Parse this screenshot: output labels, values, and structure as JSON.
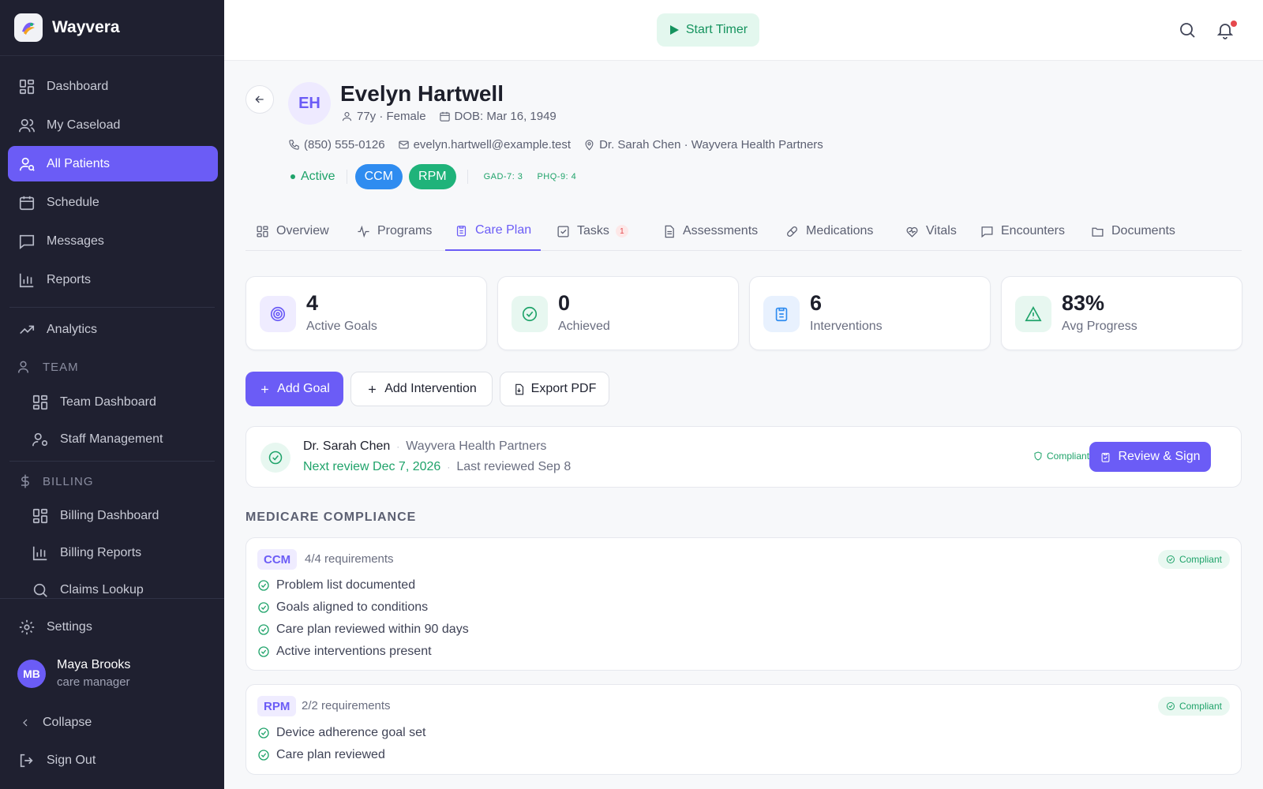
{
  "app": {
    "name": "Wayvera"
  },
  "sidebar": {
    "items": [
      {
        "label": "Dashboard",
        "icon": "dashboard-icon"
      },
      {
        "label": "My Caseload",
        "icon": "users-icon"
      },
      {
        "label": "All Patients",
        "icon": "user-search-icon",
        "active": true
      },
      {
        "label": "Schedule",
        "icon": "calendar-icon"
      },
      {
        "label": "Messages",
        "icon": "message-icon"
      },
      {
        "label": "Reports",
        "icon": "bar-chart-icon"
      },
      {
        "label": "Analytics",
        "icon": "trend-icon"
      }
    ],
    "team_section": "TEAM",
    "team_items": [
      {
        "label": "Team Dashboard",
        "icon": "dashboard-icon"
      },
      {
        "label": "Staff Management",
        "icon": "user-gear-icon"
      }
    ],
    "billing_section": "BILLING",
    "billing_items": [
      {
        "label": "Billing Dashboard",
        "icon": "dashboard-icon"
      },
      {
        "label": "Billing Reports",
        "icon": "bar-chart-icon"
      },
      {
        "label": "Claims Lookup",
        "icon": "search-icon"
      }
    ],
    "settings": "Settings",
    "user": {
      "initials": "MB",
      "name": "Maya Brooks",
      "role": "care manager"
    },
    "collapse": "Collapse",
    "sign_out": "Sign Out"
  },
  "topbar": {
    "timer_label": "Start Timer"
  },
  "patient": {
    "initials": "EH",
    "name": "Evelyn Hartwell",
    "age_sex": "77y · Female",
    "dob": "DOB: Mar 16, 1949",
    "phone": "(850) 555-0126",
    "email": "evelyn.hartwell@example.test",
    "provider": "Dr. Sarah Chen · Wayvera Health Partners",
    "status": "Active",
    "programs": [
      "CCM",
      "RPM"
    ],
    "scores": [
      "GAD-7: 3",
      "PHQ-9: 4"
    ]
  },
  "tabs": [
    {
      "label": "Overview"
    },
    {
      "label": "Programs"
    },
    {
      "label": "Care Plan",
      "active": true
    },
    {
      "label": "Tasks",
      "count": "1"
    },
    {
      "label": "Assessments"
    },
    {
      "label": "Medications"
    },
    {
      "label": "Vitals"
    },
    {
      "label": "Encounters"
    },
    {
      "label": "Documents"
    }
  ],
  "stats": [
    {
      "value": "4",
      "label": "Active Goals",
      "icon": "target-icon"
    },
    {
      "value": "0",
      "label": "Achieved",
      "icon": "check-circle-icon"
    },
    {
      "value": "6",
      "label": "Interventions",
      "icon": "clipboard-icon"
    },
    {
      "value": "83%",
      "label": "Avg Progress",
      "icon": "warning-icon"
    }
  ],
  "actions": {
    "add_goal": "Add Goal",
    "add_intervention": "Add Intervention",
    "export_pdf": "Export PDF"
  },
  "review": {
    "doctor": "Dr. Sarah Chen",
    "org": "Wayvera Health Partners",
    "next_review": "Next review Dec 7, 2026",
    "last_reviewed": "Last reviewed Sep 8",
    "status": "Compliant",
    "button": "Review & Sign"
  },
  "compliance": {
    "title": "MEDICARE COMPLIANCE",
    "programs": [
      {
        "tag": "CCM",
        "count": "4/4 requirements",
        "status": "Compliant",
        "requirements": [
          "Problem list documented",
          "Goals aligned to conditions",
          "Care plan reviewed within 90 days",
          "Active interventions present"
        ]
      },
      {
        "tag": "RPM",
        "count": "2/2 requirements",
        "status": "Compliant",
        "requirements": [
          "Device adherence goal set",
          "Care plan reviewed"
        ]
      }
    ]
  },
  "colors": {
    "accent": "#6b5cf6",
    "success": "#1fa36a",
    "sidebar": "#1f2030",
    "ccm": "#2f8cf0",
    "rpm": "#1fb37a"
  }
}
